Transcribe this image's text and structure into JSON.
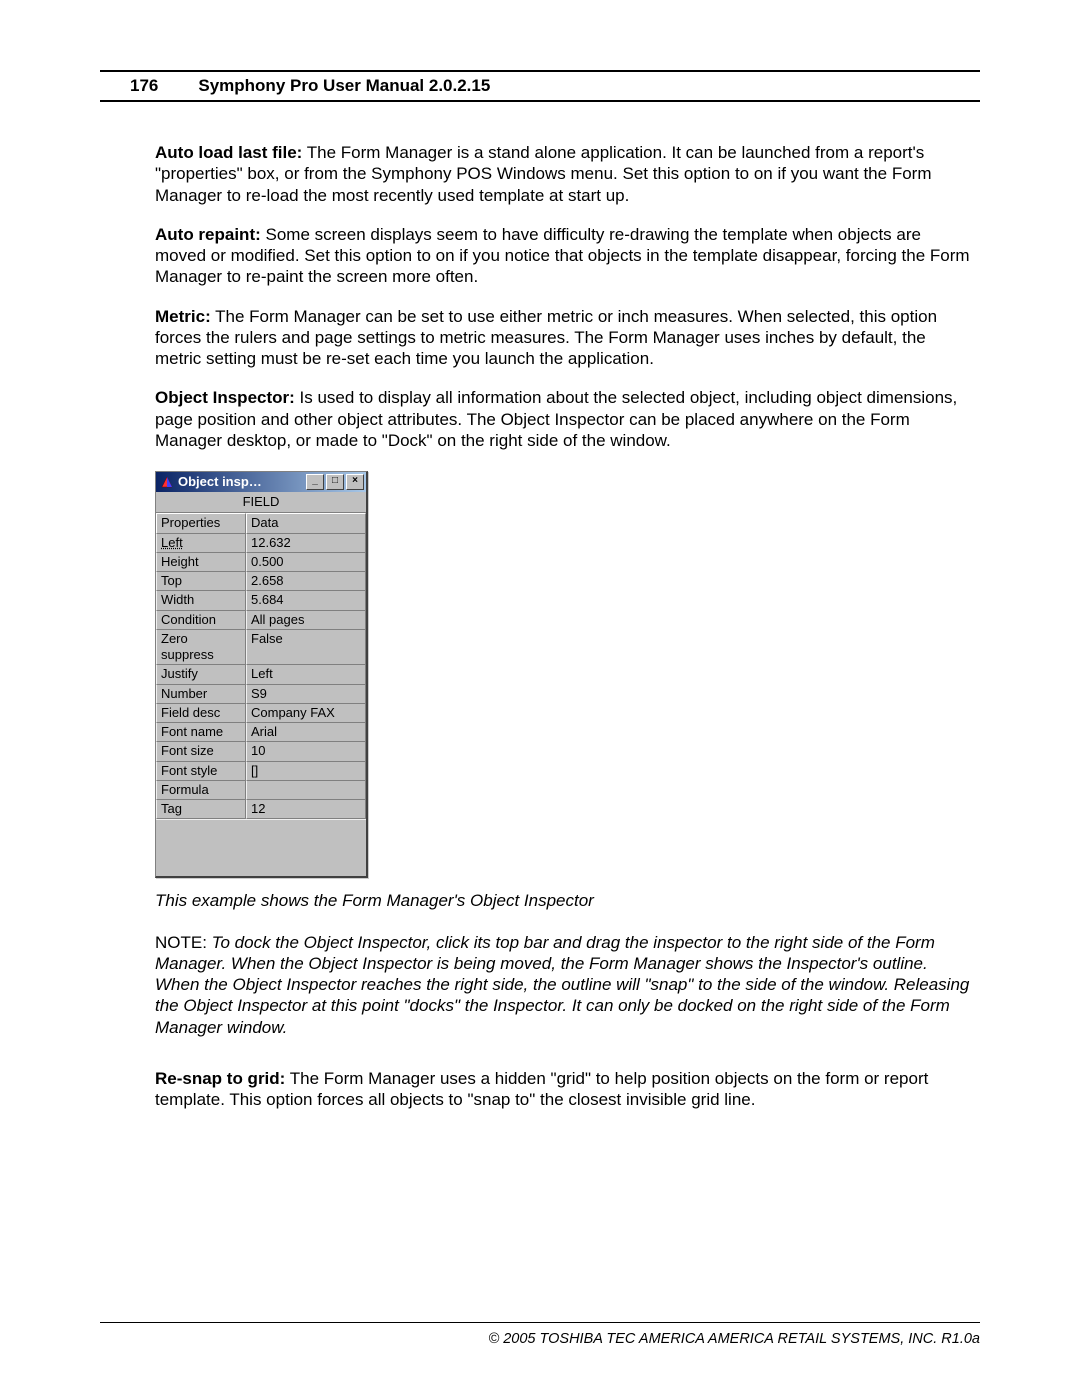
{
  "header": {
    "page_number": "176",
    "title": "Symphony Pro User Manual  2.0.2.15"
  },
  "paragraphs": {
    "p1_label": "Auto load last file:",
    "p1_body": "  The Form Manager is a stand alone application. It can be launched from a report's \"properties\" box, or from the Symphony POS Windows menu. Set this option to on if you want the Form Manager to re-load the most recently used template at start up.",
    "p2_label": "Auto repaint:",
    "p2_body": "  Some screen displays seem to have difficulty re-drawing the template when objects are moved or modified. Set this option to on if you notice that objects in the template disappear, forcing the Form Manager to re-paint the screen more often.",
    "p3_label": "Metric:",
    "p3_body": "  The Form Manager can be set to use either metric or inch measures. When selected, this option forces the rulers and page settings to metric measures. The Form Manager uses inches by default, the metric setting must be re-set each time you launch the application.",
    "p4_label": "Object Inspector:",
    "p4_body": "  Is used to display all information about the selected object, including object dimensions, page position and other object attributes. The Object Inspector can be placed anywhere on the Form Manager desktop, or made to \"Dock\" on the right side of the window."
  },
  "inspector": {
    "title": "Object insp…",
    "field_heading": "FIELD",
    "col1": "Properties",
    "col2": "Data",
    "rows": [
      {
        "label": "Left",
        "value": "12.632",
        "selected": true
      },
      {
        "label": "Height",
        "value": "0.500"
      },
      {
        "label": "Top",
        "value": "2.658"
      },
      {
        "label": "Width",
        "value": "5.684"
      },
      {
        "label": "Condition",
        "value": "All pages"
      },
      {
        "label": "Zero suppress",
        "value": "False"
      },
      {
        "label": "Justify",
        "value": "Left"
      },
      {
        "label": "Number",
        "value": "S9"
      },
      {
        "label": "Field desc",
        "value": "Company FAX"
      },
      {
        "label": "Font name",
        "value": "Arial"
      },
      {
        "label": "Font size",
        "value": "10"
      },
      {
        "label": "Font style",
        "value": "[]"
      },
      {
        "label": "Formula",
        "value": ""
      },
      {
        "label": "Tag",
        "value": "12"
      }
    ]
  },
  "caption": "This example shows the Form Manager's Object Inspector",
  "note": {
    "prefix": "NOTE: ",
    "body": "To dock the Object Inspector, click its top bar and drag the inspector to the right side of the Form Manager. When the Object Inspector is being moved, the Form Manager shows the Inspector's outline. When the Object Inspector reaches the right side, the outline will \"snap\" to the side of the window. Releasing the Object Inspector at this point \"docks\" the Inspector. It can only be docked on the right side of the Form Manager window."
  },
  "p5_label": "Re-snap to grid:",
  "p5_body": "  The Form Manager uses a hidden \"grid\" to help position objects on the form or report template. This option forces all objects to \"snap to\" the closest invisible grid line.",
  "footer": "© 2005 TOSHIBA TEC AMERICA AMERICA RETAIL SYSTEMS, INC.   R1.0a",
  "buttons": {
    "minimize": "_",
    "maximize": "□",
    "close": "×"
  }
}
